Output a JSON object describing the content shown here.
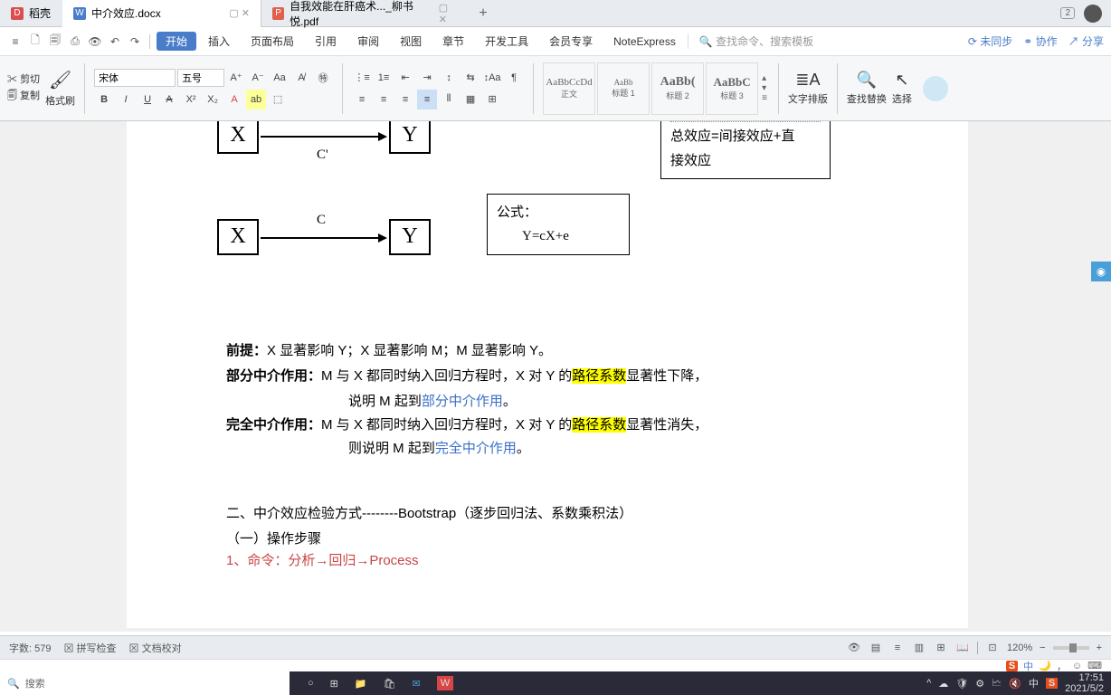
{
  "tabs": {
    "t1": "稻壳",
    "t2": "中介效应.docx",
    "t3": "自我效能在肝癌术..._柳书悦.pdf",
    "badge": "2"
  },
  "menu": {
    "file": "文件",
    "start": "开始",
    "insert": "插入",
    "layout": "页面布局",
    "ref": "引用",
    "review": "审阅",
    "view": "视图",
    "chapter": "章节",
    "devtools": "开发工具",
    "member": "会员专享",
    "noteexpress": "NoteExpress",
    "search_placeholder": "查找命令、搜索模板",
    "unsync": "未同步",
    "collab": "协作",
    "share": "分享"
  },
  "ribbon": {
    "cut": "剪切",
    "copy": "复制",
    "brush": "格式刷",
    "font": "宋体",
    "size": "五号",
    "style_body_sample": "AaBbCcDd",
    "style_body_label": "正文",
    "style_h1_sample": "AaBb",
    "style_h1_label": "标题 1",
    "style_h2_sample": "AaBb(",
    "style_h2_label": "标题 2",
    "style_h3_sample": "AaBbC",
    "style_h3_label": "标题 3",
    "text_layout": "文字排版",
    "find_replace": "查找替换",
    "select": "选择"
  },
  "doc": {
    "box_x1": "X",
    "box_y1": "Y",
    "label_c_prime": "C'",
    "box_x2": "X",
    "box_y2": "Y",
    "label_c": "C",
    "side_box1_line1": "总效应=间接效应+直",
    "side_box1_line2": "接效应",
    "formula_title": "公式：",
    "formula_body": "Y=cX+e",
    "premise_label": "前提：",
    "premise_text": "X 显著影响 Y；X 显著影响 M；M 显著影响 Y。",
    "partial_label": "部分中介作用：",
    "partial_line1_a": "M 与 X 都同时纳入回归方程时，X 对 Y 的",
    "partial_line1_hl": "路径系数",
    "partial_line1_b": "显著性下降，",
    "partial_line2_a": "说明 M 起到",
    "partial_line2_blue": "部分中介作用",
    "partial_line2_b": "。",
    "full_label": "完全中介作用：",
    "full_line1_a": "M 与 X 都同时纳入回归方程时，X 对 Y 的",
    "full_line1_hl": "路径系数",
    "full_line1_b": "显著性消失，",
    "full_line2_a": "则说明 M 起到",
    "full_line2_blue": "完全中介作用",
    "full_line2_b": "。",
    "section2": "二、中介效应检验方式--------Bootstrap（逐步回归法、系数乘积法）",
    "step_title": "（一）操作步骤",
    "step1": "1、命令：分析→回归→Process"
  },
  "status": {
    "wc_label": "字数:",
    "wc": "579",
    "spell": "拼写检查",
    "proof": "文档校对",
    "zoom": "120%"
  },
  "taskbar": {
    "search": "搜索",
    "time": "17:51",
    "date": "2021/5/2"
  }
}
